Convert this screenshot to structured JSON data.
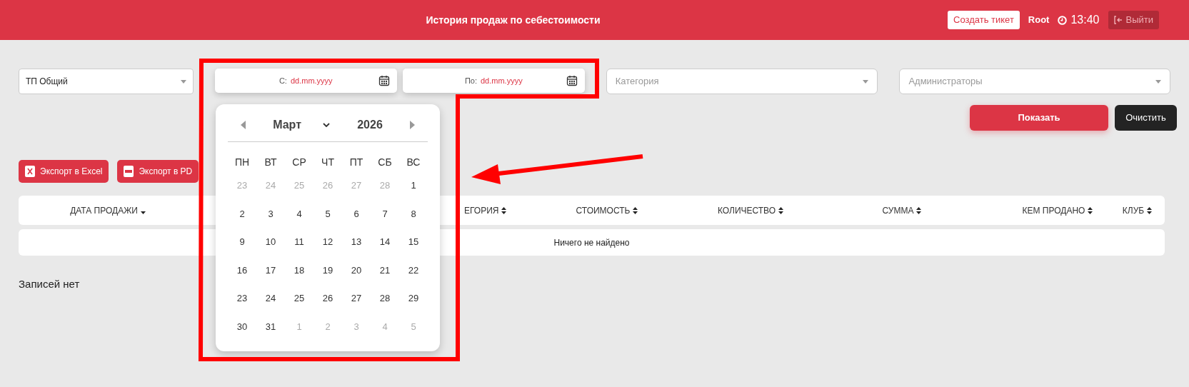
{
  "header": {
    "title": "История продаж по себестоимости",
    "ticket_button": "Создать тикет",
    "user": "Root",
    "time": "13:40",
    "logout_button": "Выйти"
  },
  "filters": {
    "club_select": {
      "value": "ТП Общий"
    },
    "date_from": {
      "label": "С:",
      "placeholder": "dd.mm.yyyy"
    },
    "date_to": {
      "label": "По:",
      "placeholder": "dd.mm.yyyy"
    },
    "category_select": {
      "placeholder": "Категория"
    },
    "admins_select": {
      "placeholder": "Администраторы"
    }
  },
  "actions": {
    "show_button": "Показать",
    "clear_button": "Очистить"
  },
  "exports": [
    {
      "kind": "excel",
      "label": "Экспорт в Excel"
    },
    {
      "kind": "pdf",
      "label": "Экспорт в PD"
    }
  ],
  "table": {
    "columns": [
      {
        "label": "ДАТА ПРОДАЖИ",
        "sorted": true
      },
      {
        "label": "ЕГОРИЯ",
        "sorted": false
      },
      {
        "label": "СТОИМОСТЬ",
        "sorted": false
      },
      {
        "label": "КОЛИЧЕСТВО",
        "sorted": false
      },
      {
        "label": "СУММА",
        "sorted": false
      },
      {
        "label": "КЕМ ПРОДАНО",
        "sorted": false
      },
      {
        "label": "КЛУБ",
        "sorted": false
      }
    ],
    "empty_message": "Ничего не найдено"
  },
  "records_note": "Записей нет",
  "calendar": {
    "month": "Март",
    "year": "2026",
    "weekdays": [
      "ПН",
      "ВТ",
      "СР",
      "ЧТ",
      "ПТ",
      "СБ",
      "ВС"
    ],
    "weeks": [
      [
        {
          "day": "23",
          "outside": true
        },
        {
          "day": "24",
          "outside": true
        },
        {
          "day": "25",
          "outside": true
        },
        {
          "day": "26",
          "outside": true
        },
        {
          "day": "27",
          "outside": true
        },
        {
          "day": "28",
          "outside": true
        },
        {
          "day": "1",
          "outside": false
        }
      ],
      [
        {
          "day": "2",
          "outside": false
        },
        {
          "day": "3",
          "outside": false
        },
        {
          "day": "4",
          "outside": false
        },
        {
          "day": "5",
          "outside": false
        },
        {
          "day": "6",
          "outside": false
        },
        {
          "day": "7",
          "outside": false
        },
        {
          "day": "8",
          "outside": false
        }
      ],
      [
        {
          "day": "9",
          "outside": false
        },
        {
          "day": "10",
          "outside": false
        },
        {
          "day": "11",
          "outside": false
        },
        {
          "day": "12",
          "outside": false
        },
        {
          "day": "13",
          "outside": false
        },
        {
          "day": "14",
          "outside": false
        },
        {
          "day": "15",
          "outside": false
        }
      ],
      [
        {
          "day": "16",
          "outside": false
        },
        {
          "day": "17",
          "outside": false
        },
        {
          "day": "18",
          "outside": false
        },
        {
          "day": "19",
          "outside": false
        },
        {
          "day": "20",
          "outside": false
        },
        {
          "day": "21",
          "outside": false
        },
        {
          "day": "22",
          "outside": false
        }
      ],
      [
        {
          "day": "23",
          "outside": false
        },
        {
          "day": "24",
          "outside": false
        },
        {
          "day": "25",
          "outside": false
        },
        {
          "day": "26",
          "outside": false
        },
        {
          "day": "27",
          "outside": false
        },
        {
          "day": "28",
          "outside": false
        },
        {
          "day": "29",
          "outside": false
        }
      ],
      [
        {
          "day": "30",
          "outside": false
        },
        {
          "day": "31",
          "outside": false
        },
        {
          "day": "1",
          "outside": true
        },
        {
          "day": "2",
          "outside": true
        },
        {
          "day": "3",
          "outside": true
        },
        {
          "day": "4",
          "outside": true
        },
        {
          "day": "5",
          "outside": true
        }
      ]
    ]
  }
}
